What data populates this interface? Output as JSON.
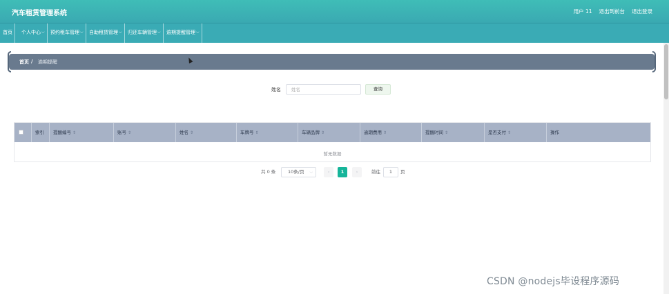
{
  "header": {
    "app_title": "汽车租赁管理系统",
    "user_label": "用户 11",
    "back_label": "退出到前台",
    "logout_label": "退出登录"
  },
  "nav": {
    "items": [
      {
        "label": "首页"
      },
      {
        "label": "个人中心"
      },
      {
        "label": "预约租车管理"
      },
      {
        "label": "自助租赁管理"
      },
      {
        "label": "归还车辆管理"
      },
      {
        "label": "逾期提醒管理"
      }
    ],
    "chevron": "chevron-down-icon"
  },
  "breadcrumb": {
    "home": "首页",
    "separator": "/",
    "current": "逾期提醒"
  },
  "search": {
    "label": "姓名",
    "placeholder": "姓名",
    "button": "查询"
  },
  "table": {
    "columns": [
      "索引",
      "提醒编号",
      "账号",
      "姓名",
      "车牌号",
      "车辆品牌",
      "逾期费用",
      "提醒时间",
      "是否支付",
      "操作"
    ],
    "empty_text": "暂无数据"
  },
  "pagination": {
    "total": "共 0 条",
    "page_size": "10条/页",
    "prev": "‹",
    "current_page": "1",
    "next": "›",
    "goto_label": "前往",
    "goto_value": "1",
    "page_suffix": "页"
  },
  "watermark": "CSDN @nodejs毕设程序源码",
  "colors": {
    "header": "#3fbdb7",
    "navbar": "#3aabb5",
    "breadcrumb": "#697a8e",
    "table_header": "#a7b2c6",
    "page_active": "#16b59a"
  }
}
